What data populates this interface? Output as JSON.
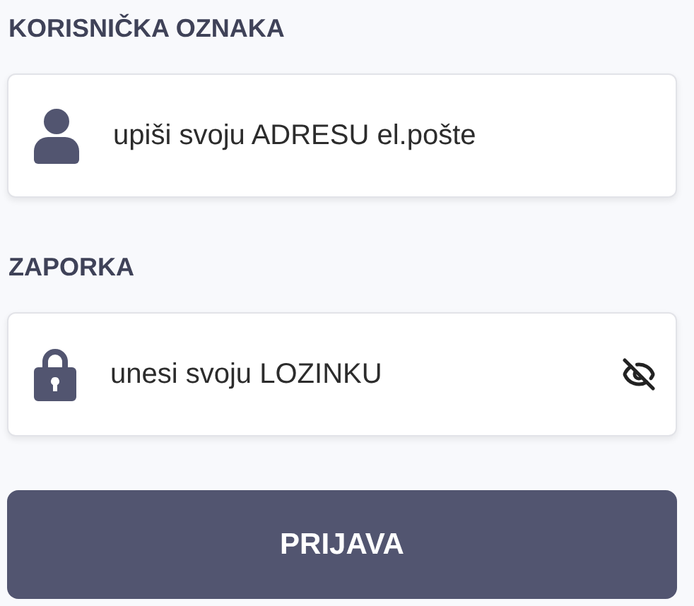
{
  "fields": [
    {
      "kind": "email",
      "label": "KORISNIČKA OZNAKA",
      "placeholder": "upiši svoju ADRESU el.pošte"
    },
    {
      "kind": "password",
      "label": "ZAPORKA",
      "placeholder": "unesi svoju LOZINKU",
      "password_visible": false
    }
  ],
  "submit_button": "PRIJAVA"
}
